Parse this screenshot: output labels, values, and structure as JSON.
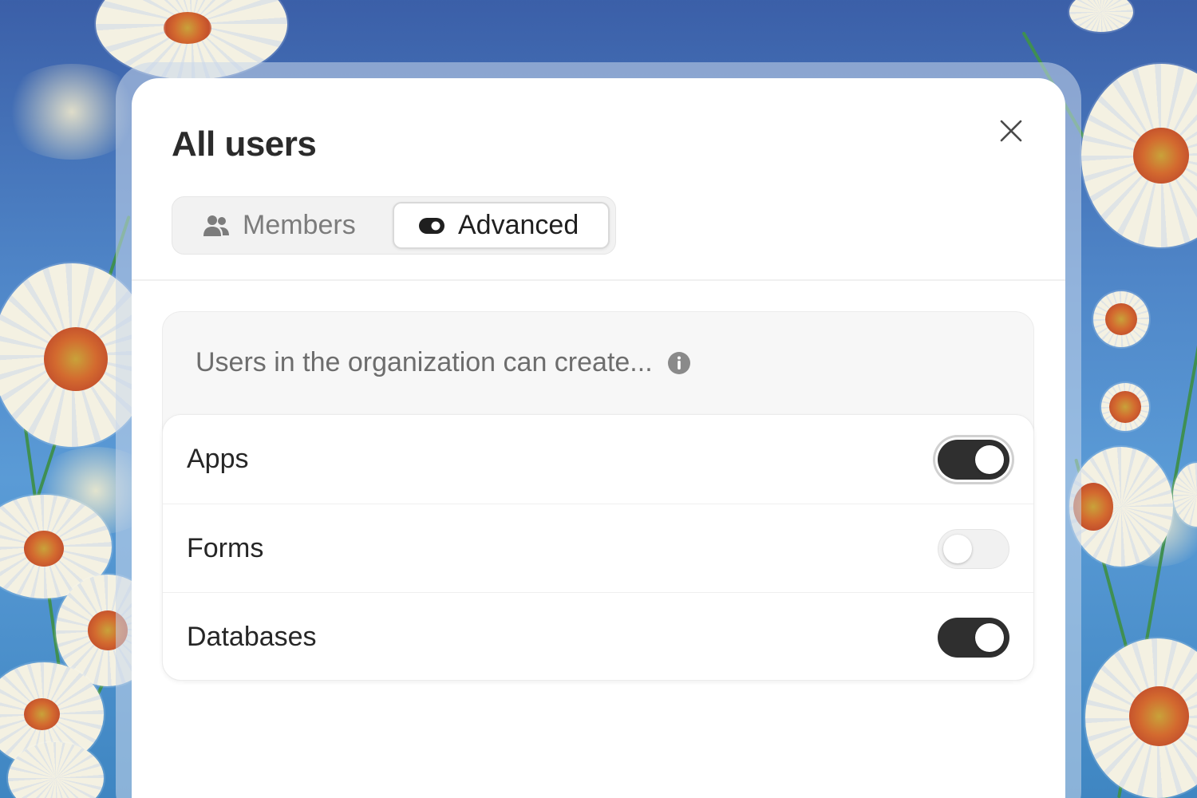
{
  "dialog": {
    "title": "All users",
    "close_icon": "close-icon"
  },
  "tabs": [
    {
      "label": "Members",
      "icon": "users-icon",
      "selected": false
    },
    {
      "label": "Advanced",
      "icon": "toggle-icon",
      "selected": true
    }
  ],
  "permissions": {
    "heading": "Users in the organization can create...",
    "info_icon": "info-icon",
    "items": [
      {
        "label": "Apps",
        "enabled": true
      },
      {
        "label": "Forms",
        "enabled": false
      },
      {
        "label": "Databases",
        "enabled": true
      }
    ]
  },
  "colors": {
    "toggle_on": "#2f2f2f",
    "toggle_off": "#f1f1f1",
    "background_sky": "#4f86c8"
  }
}
